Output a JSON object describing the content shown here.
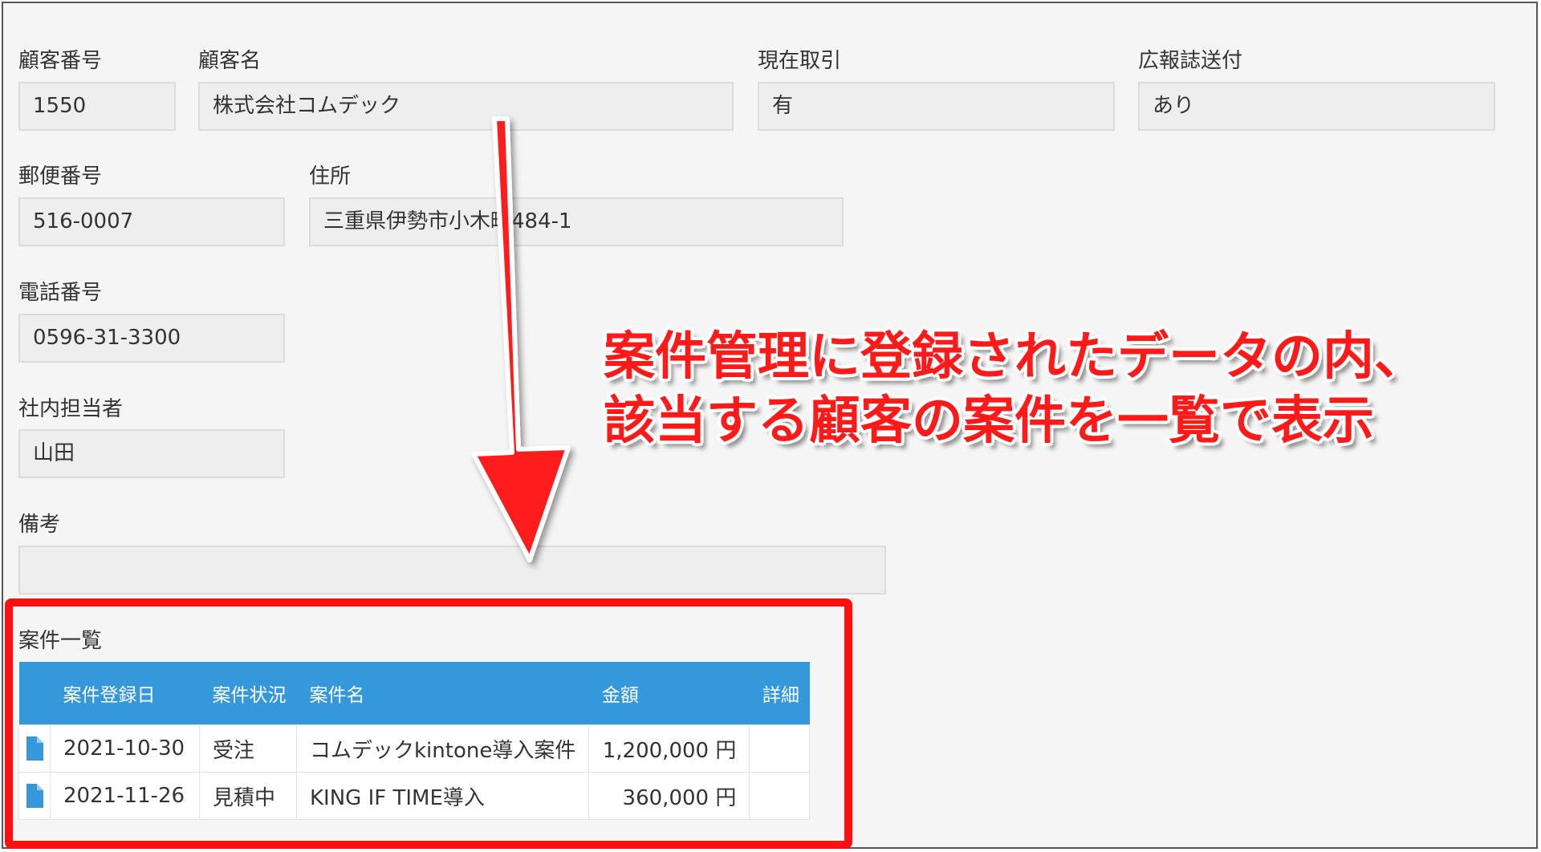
{
  "fields": {
    "customer_number": {
      "label": "顧客番号",
      "value": "1550"
    },
    "customer_name": {
      "label": "顧客名",
      "value": "株式会社コムデック"
    },
    "current_deal": {
      "label": "現在取引",
      "value": "有"
    },
    "newsletter": {
      "label": "広報誌送付",
      "value": "あり"
    },
    "postal_code": {
      "label": "郵便番号",
      "value": "516-0007"
    },
    "address": {
      "label": "住所",
      "value": "三重県伊勢市小木町484-1"
    },
    "phone": {
      "label": "電話番号",
      "value": "0596-31-3300"
    },
    "staff": {
      "label": "社内担当者",
      "value": "山田"
    },
    "remarks": {
      "label": "備考",
      "value": ""
    }
  },
  "subtable": {
    "title": "案件一覧",
    "headers": {
      "date": "案件登録日",
      "status": "案件状況",
      "name": "案件名",
      "amount": "金額",
      "detail": "詳細"
    },
    "rows": [
      {
        "date": "2021-10-30",
        "status": "受注",
        "name": "コムデックkintone導入案件",
        "amount": "1,200,000 円",
        "icon": "document-icon"
      },
      {
        "date": "2021-11-26",
        "status": "見積中",
        "name": "KING IF TIME導入",
        "amount": "360,000 円",
        "icon": "document-icon"
      }
    ]
  },
  "annotation": {
    "line1": "案件管理に登録されたデータの内、",
    "line2": "該当する顧客の案件を一覧で表示",
    "color": "#ff1a1a"
  },
  "colors": {
    "header_blue": "#3498db",
    "highlight_red": "#ff1010"
  }
}
